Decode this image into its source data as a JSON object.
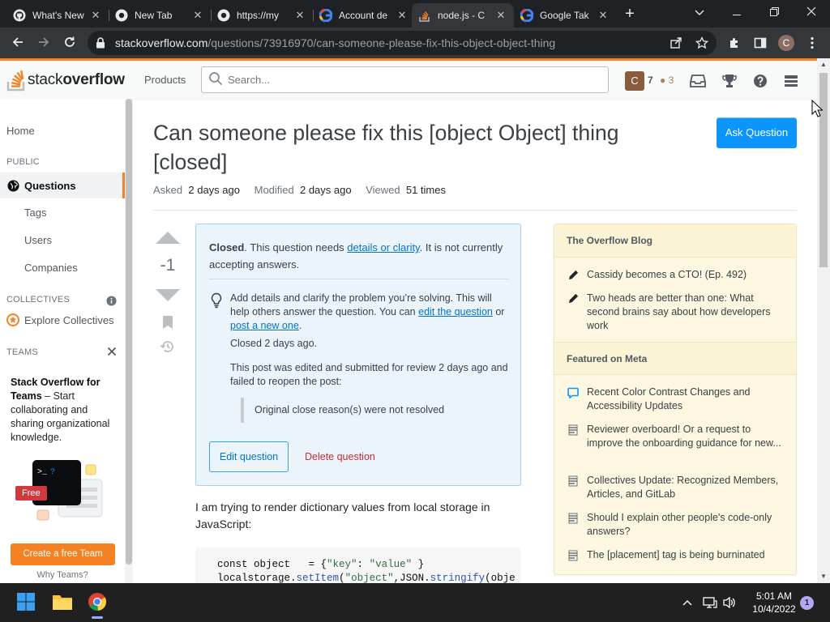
{
  "browser": {
    "tabs": [
      {
        "title": "What's New",
        "icon": "github-icon",
        "active": false
      },
      {
        "title": "New Tab",
        "icon": "github-icon",
        "active": false
      },
      {
        "title": "https://my",
        "icon": "github-icon",
        "active": false
      },
      {
        "title": "Account de",
        "icon": "google-icon",
        "active": false
      },
      {
        "title": "node.js - C",
        "icon": "stackoverflow-icon",
        "active": true
      },
      {
        "title": "Google Tak",
        "icon": "google-icon",
        "active": false
      }
    ],
    "url_host": "stackoverflow.com",
    "url_path": "/questions/73916970/can-someone-please-fix-this-object-object-thing",
    "profile_initial": "C"
  },
  "so_header": {
    "logo_text_plain": "stack",
    "logo_text_bold": "overflow",
    "products_label": "Products",
    "search_placeholder": "Search...",
    "avatar_initial": "C",
    "reputation": "7",
    "bronze_badges": "3"
  },
  "left_nav": {
    "home": "Home",
    "public_label": "PUBLIC",
    "questions": "Questions",
    "tags": "Tags",
    "users": "Users",
    "companies": "Companies",
    "collectives_label": "COLLECTIVES",
    "explore_collectives": "Explore Collectives",
    "teams_label": "TEAMS",
    "teams_promo_title": "Stack Overflow for Teams",
    "teams_promo_dash": " – ",
    "teams_promo_text": "Start collaborating and sharing organizational knowledge.",
    "free_badge": "Free",
    "create_team_button": "Create a free Team",
    "why_teams": "Why Teams?"
  },
  "question": {
    "title": "Can someone please fix this [object Object] thing [closed]",
    "ask_button": "Ask Question",
    "asked_label": "Asked",
    "asked_value": "2 days ago",
    "modified_label": "Modified",
    "modified_value": "2 days ago",
    "viewed_label": "Viewed",
    "viewed_value": "51 times",
    "score": "-1",
    "body": "I am trying to render dictionary values from local storage in JavaScript:",
    "code_line1_a": "const object   = {",
    "code_line1_b": "\"key\"",
    "code_line1_c": ": ",
    "code_line1_d": "\"value\"",
    "code_line1_e": " }",
    "code_line2_a": "localstorage.",
    "code_line2_b": "setItem",
    "code_line2_c": "(",
    "code_line2_d": "\"object\"",
    "code_line2_e": ",",
    "code_line2_f": "JSON",
    "code_line2_g": ".",
    "code_line2_h": "stringify",
    "code_line2_i": "(obje"
  },
  "closed_notice": {
    "closed_word": "Closed",
    "line1_a": ". This question needs ",
    "details_link": "details or clarity",
    "line1_b": ". It is not currently accepting answers.",
    "hint_a": "Add details and clarify the problem you’re solving. This will help others answer the question. You can ",
    "edit_link": "edit the question",
    "hint_b": " or ",
    "new_link": "post a new one",
    "hint_c": ".",
    "closed_ago": "Closed 2 days ago.",
    "review_text": "This post was edited and submitted for review 2 days ago and failed to reopen the post:",
    "quote": "Original close reason(s) were not resolved",
    "edit_button": "Edit question",
    "delete_button": "Delete question"
  },
  "sidebar": {
    "blog_heading": "The Overflow Blog",
    "blog_items": [
      "Cassidy becomes a CTO! (Ep. 492)",
      "Two heads are better than one: What second brains say about how developers work"
    ],
    "meta_heading": "Featured on Meta",
    "meta_items": [
      "Recent Color Contrast Changes and Accessibility Updates",
      "Reviewer overboard! Or a request to improve the onboarding guidance for new...",
      "Collectives Update: Recognized Members, Articles, and GitLab",
      "Should I explain other people's code-only answers?",
      "The [placement] tag is being burninated"
    ]
  },
  "taskbar": {
    "time": "5:01 AM",
    "date": "10/4/2022",
    "notification_count": "1"
  },
  "colors": {
    "so_orange": "#f48225",
    "so_blue": "#0a95ff",
    "link_blue": "#0074cc",
    "notice_bg": "#ebf4fb",
    "widget_bg": "#fdf7e2",
    "delete_red": "#c22e32"
  }
}
